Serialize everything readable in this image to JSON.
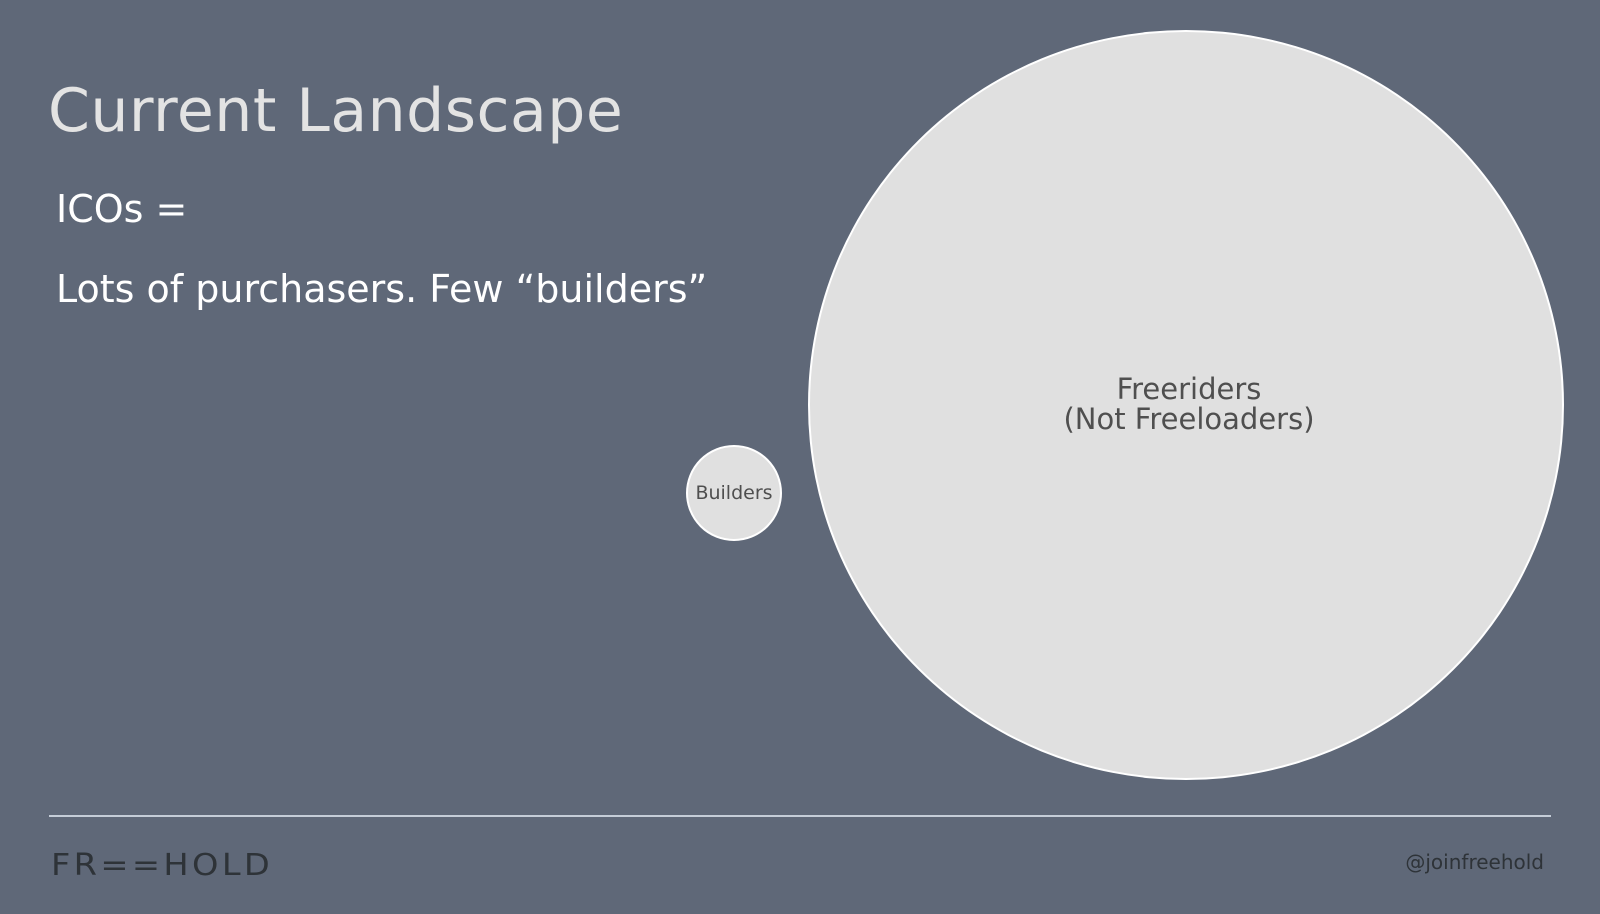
{
  "slide": {
    "title": "Current Landscape",
    "bullets": [
      "ICOs =",
      "Lots of purchasers. Few “builders”"
    ]
  },
  "diagram": {
    "builders_label": "Builders",
    "freeriders_label_line1": "Freeriders",
    "freeriders_label_line2": "(Not Freeloaders)"
  },
  "footer": {
    "logo_text": "FR==HOLD",
    "handle": "@joinfreehold"
  },
  "colors": {
    "background": "#5f6878",
    "circle_fill": "#e0e0e0",
    "circle_stroke": "#ffffff",
    "title": "#e3e3e3",
    "body_text": "#ffffff",
    "footer_text": "#2e3338",
    "divider": "#c5cdd8"
  }
}
